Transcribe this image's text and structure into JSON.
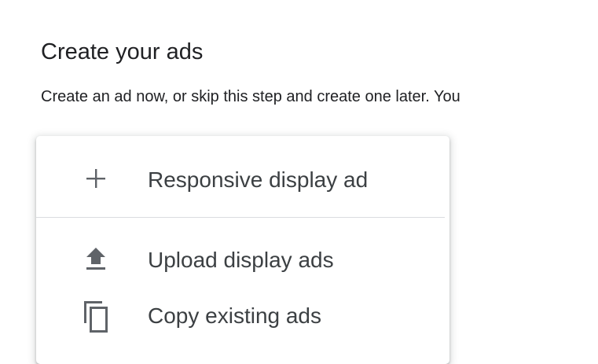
{
  "section": {
    "title": "Create your ads",
    "description": "Create an ad now, or skip this step and create one later. You"
  },
  "menu": {
    "items": [
      {
        "icon": "plus-icon",
        "label": "Responsive display ad"
      },
      {
        "icon": "upload-icon",
        "label": "Upload display ads"
      },
      {
        "icon": "copy-icon",
        "label": "Copy existing ads"
      }
    ]
  },
  "colors": {
    "text": "#202124",
    "menu_text": "#3c4043",
    "icon": "#5f6368",
    "divider": "#dadce0"
  }
}
